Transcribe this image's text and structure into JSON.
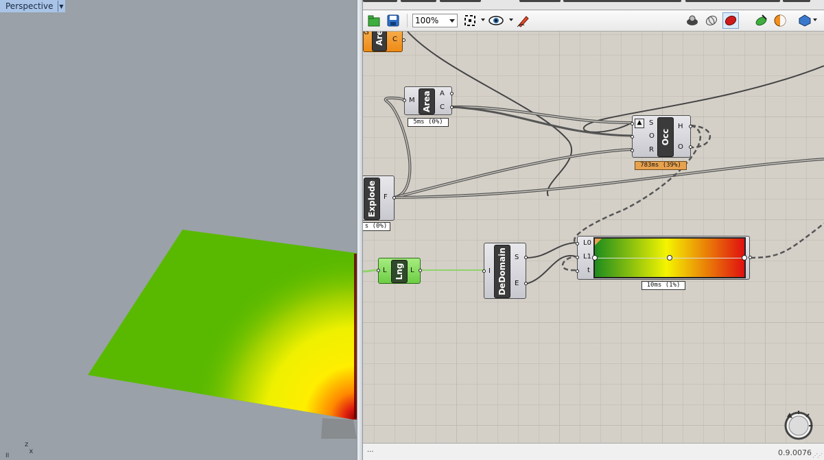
{
  "viewport": {
    "label": "Perspective",
    "axis_label": "Z\nX",
    "corner_label": "II"
  },
  "toolbar": {
    "zoom_value": "100%",
    "icons": [
      "open-file-icon",
      "save-icon",
      "zoom-extents-icon",
      "preview-eye-icon",
      "sketch-pen-icon",
      "preview-off-icon",
      "wireframe-preview-icon",
      "shaded-preview-icon",
      "selected-only-icon",
      "display-color-icon",
      "bounding-box-icon"
    ]
  },
  "components": {
    "area_top": {
      "name": "Are",
      "inputs": [
        "G"
      ],
      "outputs": [
        "C"
      ],
      "color": "#f39a2c"
    },
    "area": {
      "name": "Area",
      "inputs": [
        "M"
      ],
      "outputs": [
        "A",
        "C"
      ],
      "time": "5ms (0%)"
    },
    "occ": {
      "name": "Occ",
      "inputs": [
        "S",
        "O",
        "R"
      ],
      "outputs": [
        "H",
        "O"
      ],
      "time": "783ms (39%)"
    },
    "explode": {
      "name": "Explode",
      "outputs": [
        "F"
      ],
      "time": "s (0%)"
    },
    "lng": {
      "name": "Lng",
      "inputs": [
        "L"
      ],
      "outputs": [
        "L"
      ],
      "color": "#7fd65a"
    },
    "dedomain": {
      "name": "DeDomain",
      "inputs": [
        "I"
      ],
      "outputs": [
        "S",
        "E"
      ]
    },
    "gradient": {
      "inputs": [
        "L0",
        "L1",
        "t"
      ],
      "time": "10ms (1%)",
      "colors": [
        "#1e8c1e",
        "#f4f400",
        "#e01010"
      ]
    }
  },
  "status": {
    "left": "...",
    "version": "0.9.0076"
  },
  "colors": {
    "viewport_bg": "#9aa1a8",
    "canvas_bg": "#d4d0c8",
    "surface_green": "#59b900"
  }
}
